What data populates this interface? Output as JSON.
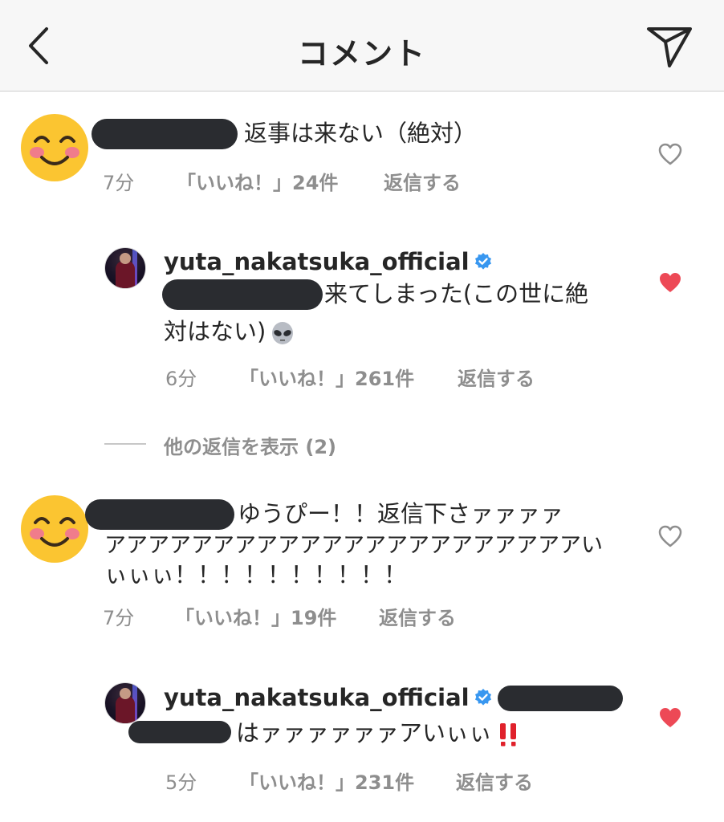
{
  "header": {
    "title": "コメント"
  },
  "comments": [
    {
      "text": "返事は来ない（絶対）",
      "time": "7分",
      "likes": "「いいね！」24件",
      "reply": "返信する"
    },
    {
      "username": "yuta_nakatsuka_official",
      "line1": "来てしまった(この世に絶",
      "line2": "対はない)",
      "time": "6分",
      "likes": "「いいね！」261件",
      "reply": "返信する"
    },
    {
      "line1": "ゆうぴー！！返信下さァァァァ",
      "line2": "アアアアアアアアアアアアアアアアアアアアアアい",
      "line3": "ぃぃぃ！！！！！！！！！！",
      "time": "7分",
      "likes": "「いいね！」19件",
      "reply": "返信する"
    },
    {
      "username": "yuta_nakatsuka_official",
      "line1": "はァァァァァァアいぃぃ",
      "time": "5分",
      "likes": "「いいね！」231件",
      "reply": "返信する"
    }
  ],
  "view_more": "他の返信を表示 (2)",
  "colors": {
    "liked": "#ed4956",
    "verified": "#3897f0",
    "meta": "#8e8e8e"
  },
  "icons": [
    "back-chevron-icon",
    "send-icon",
    "heart-outline-icon",
    "heart-filled-icon",
    "verified-badge-icon",
    "alien-emoji-icon",
    "double-exclamation-icon"
  ]
}
